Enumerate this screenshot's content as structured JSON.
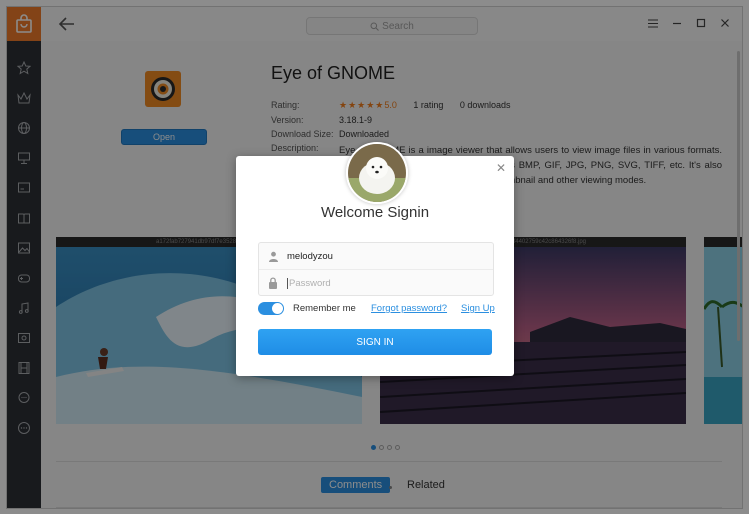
{
  "search": {
    "placeholder": "Search"
  },
  "sidebar": {
    "items": [
      "star-icon",
      "crown-icon",
      "globe-icon",
      "presentation-icon",
      "monitor-icon",
      "book-icon",
      "image-icon",
      "gamepad-icon",
      "music-icon",
      "video-icon",
      "film-icon",
      "chat-icon",
      "more-icon"
    ]
  },
  "app": {
    "name": "Eye of GNOME",
    "open_label": "Open",
    "rating_label": "Rating:",
    "rating_value": "5.0",
    "rating_count": "1 rating",
    "downloads": "0 downloads",
    "version_label": "Version:",
    "version": "3.18.1-9",
    "download_size_label": "Download Size:",
    "download_size": "Downloaded",
    "description_label": "Description:",
    "description": "Eye of GNOME is a image viewer that allows users to view image files in various formats. It supports a number of formats such as BMP, GIF, JPG, PNG, SVG, TIFF, etc. It's also available in slide display, full screen, thumbnail and other viewing modes."
  },
  "screenshots": {
    "shot1_title": "a172fab727941db97df7e35280...",
    "shot2_title": "...5f4402759c42c864326f8.jpg"
  },
  "tabs": {
    "comments": "Comments",
    "related": "Related"
  },
  "dialog": {
    "title": "Welcome Signin",
    "username": "melodyzou",
    "password_placeholder": "Password",
    "remember_label": "Remember me",
    "forgot_label": "Forgot password?",
    "signup_label": "Sign Up",
    "signin_label": "SIGN IN"
  },
  "colors": {
    "accent": "#2b8fe0",
    "brand": "#ee7a2a",
    "sidebar": "#2d3035",
    "star": "#f07d1c"
  }
}
